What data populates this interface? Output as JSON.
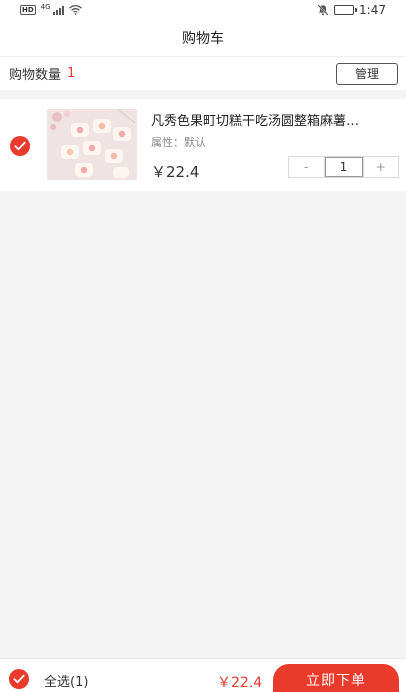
{
  "status_bar": {
    "hd_label": "HD",
    "network_label": "4G",
    "time": "1:47"
  },
  "header": {
    "title": "购物车"
  },
  "summary": {
    "label": "购物数量",
    "count": "1",
    "manage_label": "管理"
  },
  "cart_items": [
    {
      "name": "凡秀色果町切糕干吃汤圆整箱麻薯…",
      "attribute": "属性：默认",
      "price": "￥22.4",
      "quantity": "1",
      "minus_label": "-",
      "plus_label": "+",
      "checked": true
    }
  ],
  "footer": {
    "select_all_label": "全选(1)",
    "total": "￥22.4",
    "order_label": "立即下单"
  },
  "colors": {
    "accent": "#e83b2c",
    "background": "#f4f4f4"
  },
  "icons": {
    "check": "check-icon",
    "wifi": "wifi-icon",
    "signal": "signal-icon",
    "mute": "mute-icon",
    "battery": "battery-icon"
  }
}
